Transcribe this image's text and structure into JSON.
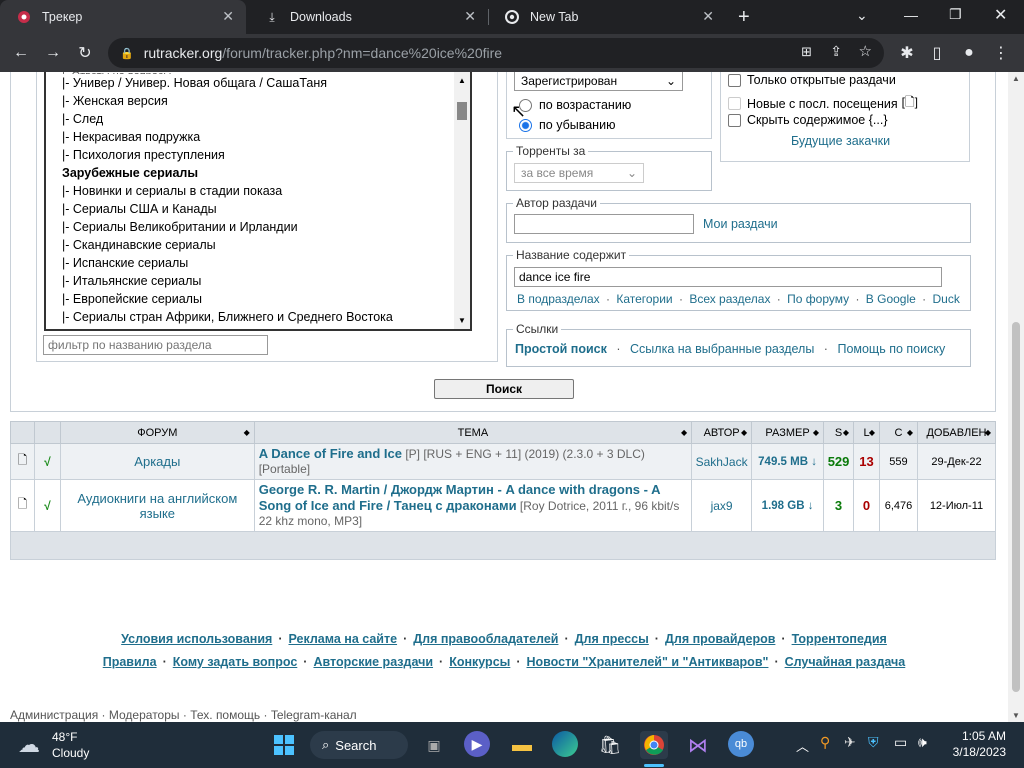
{
  "browser": {
    "tabs": [
      {
        "title": "Трекер",
        "active": true
      },
      {
        "title": "Downloads",
        "active": false
      },
      {
        "title": "New Tab",
        "active": false
      }
    ],
    "url_domain": "rutracker.org",
    "url_path": "/forum/tracker.php?nm=dance%20ice%20fire"
  },
  "categories": [
    {
      "label": "|- Универ / Универ. Новая общага / СашаТаня",
      "group": false
    },
    {
      "label": "|- Женская версия",
      "group": false
    },
    {
      "label": "|- След",
      "group": false
    },
    {
      "label": "|- Некрасивая подружка",
      "group": false
    },
    {
      "label": "|- Психология преступления",
      "group": false
    },
    {
      "label": "Зарубежные сериалы",
      "group": true
    },
    {
      "label": "|- Новинки и сериалы в стадии показа",
      "group": false
    },
    {
      "label": "|- Сериалы США и Канады",
      "group": false
    },
    {
      "label": "|- Сериалы Великобритании и Ирландии",
      "group": false
    },
    {
      "label": "|- Скандинавские сериалы",
      "group": false
    },
    {
      "label": "|- Испанские сериалы",
      "group": false
    },
    {
      "label": "|- Итальянские сериалы",
      "group": false
    },
    {
      "label": "|- Европейские сериалы",
      "group": false
    },
    {
      "label": "|- Сериалы стран Африки, Ближнего и Среднего Востока",
      "group": false
    }
  ],
  "filter_placeholder": "фильтр по названию раздела",
  "sort": {
    "order_select": "Зарегистрирован",
    "asc": "по возрастанию",
    "desc": "по убыванию"
  },
  "options": {
    "only_open": "Только открытые раздачи",
    "new_since": "Новые с посл. посещения",
    "hide_content": "Скрыть содержимое {...}",
    "future_link": "Будущие закачки"
  },
  "period": {
    "legend": "Торренты за",
    "value": "за все время"
  },
  "author": {
    "legend": "Автор раздачи",
    "my_link": "Мои раздачи"
  },
  "title_search": {
    "legend": "Название содержит",
    "value": "dance ice fire",
    "links": [
      "В подразделах",
      "Категории",
      "Всех разделах",
      "По форуму",
      "В Google",
      "Duck"
    ]
  },
  "links_box": {
    "legend": "Ссылки",
    "simple": "Простой поиск",
    "selected": "Ссылка на выбранные разделы",
    "help": "Помощь по поиску"
  },
  "search_button": "Поиск",
  "table": {
    "headers": [
      "ФОРУМ",
      "ТЕМА",
      "АВТОР",
      "РАЗМЕР",
      "S",
      "L",
      "C",
      "ДОБАВЛЕН"
    ],
    "rows": [
      {
        "check": "√",
        "forum": "Аркады",
        "title": "A Dance of Fire and Ice",
        "title_extra": "[P] [RUS + ENG + 11] (2019) (2.3.0 + 3 DLC) [Portable]",
        "author": "SakhJack",
        "size": "749.5 MB ↓",
        "seeds": "529",
        "leech": "13",
        "completed": "559",
        "added": "29-Дек-22"
      },
      {
        "check": "√",
        "forum": "Аудиокниги на английском языке",
        "title": "George R. R. Martin / Джордж Мартин - A dance with dragons - A Song of Ice and Fire / Танец с драконами",
        "title_extra": "[Roy Dotrice, 2011 г., 96 kbit/s 22 khz mono, MP3]",
        "author": "jax9",
        "size": "1.98 GB ↓",
        "seeds": "3",
        "leech": "0",
        "completed": "6,476",
        "added": "12-Июл-11"
      }
    ]
  },
  "footer": {
    "line1": [
      "Условия использования",
      "Реклама на сайте",
      "Для правообладателей",
      "Для прессы",
      "Для провайдеров",
      "Торрентопедия"
    ],
    "line2": [
      "Правила",
      "Кому задать вопрос",
      "Авторские раздачи",
      "Конкурсы",
      "Новости \"Хранителей\" и \"Антикваров\"",
      "Случайная раздача"
    ],
    "bottom": [
      "Администрация",
      "Модераторы",
      "Тех. помощь",
      "Telegram-канал"
    ]
  },
  "taskbar": {
    "weather_temp": "48°F",
    "weather_desc": "Cloudy",
    "search_label": "Search",
    "time": "1:05 AM",
    "date": "3/18/2023"
  }
}
